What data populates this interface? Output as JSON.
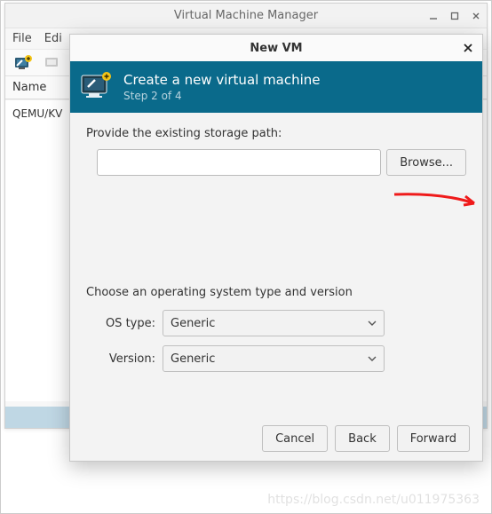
{
  "main_window": {
    "title": "Virtual Machine Manager",
    "menu": {
      "file": "File",
      "edit": "Edi"
    },
    "columns": {
      "name": "Name"
    },
    "rows": [
      {
        "label": "QEMU/KV"
      }
    ]
  },
  "dialog": {
    "title": "New VM",
    "banner_title": "Create a new virtual machine",
    "banner_step": "Step 2 of 4",
    "storage_label": "Provide the existing storage path:",
    "storage_value": "",
    "browse_button": "Browse...",
    "os_section_label": "Choose an operating system type and version",
    "os_type_label": "OS type:",
    "os_type_value": "Generic",
    "version_label": "Version:",
    "version_value": "Generic",
    "buttons": {
      "cancel": "Cancel",
      "back": "Back",
      "forward": "Forward"
    }
  },
  "watermark": "https://blog.csdn.net/u011975363"
}
